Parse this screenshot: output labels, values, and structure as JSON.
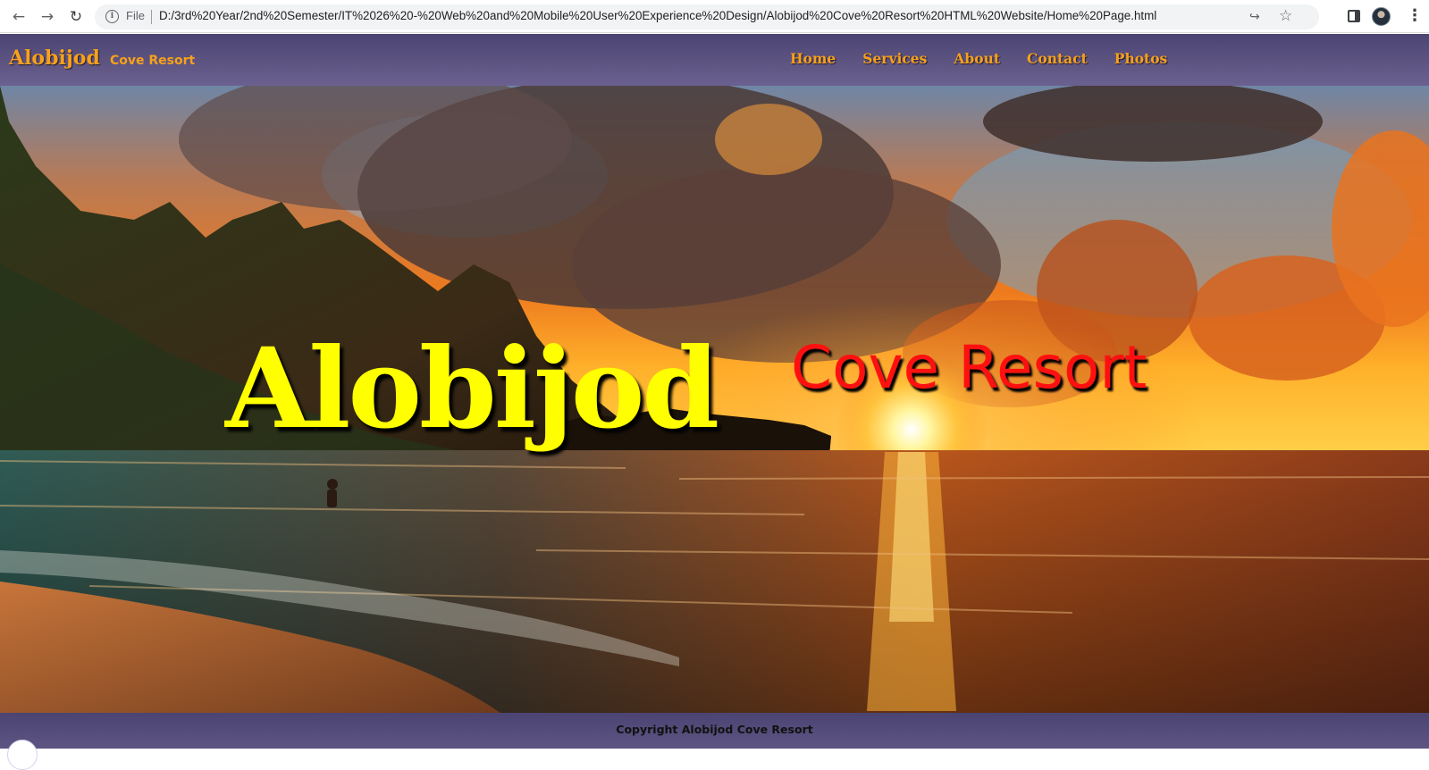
{
  "browser": {
    "scheme_label": "File",
    "url": "D:/3rd%20Year/2nd%20Semester/IT%2026%20-%20Web%20and%20Mobile%20User%20Experience%20Design/Alobijod%20Cove%20Resort%20HTML%20Website/Home%20Page.html",
    "icons": [
      "back-icon",
      "forward-icon",
      "reload-icon",
      "info-icon",
      "share-icon",
      "bookmark-star-icon",
      "side-panel-icon",
      "profile-avatar",
      "menu-icon"
    ]
  },
  "header": {
    "brand_name": "Alobijod",
    "brand_sub": "Cove Resort",
    "nav": [
      "Home",
      "Services",
      "About",
      "Contact",
      "Photos"
    ]
  },
  "hero": {
    "title": "Alobijod",
    "subtitle": "Cove Resort"
  },
  "footer": {
    "copyright": "Copyright Alobijod Cove Resort"
  },
  "colors": {
    "header_bg": "#5d5482",
    "brand_orange": "#f7a11a",
    "hero_title": "#ffff00",
    "hero_subtitle": "#ff1010"
  }
}
